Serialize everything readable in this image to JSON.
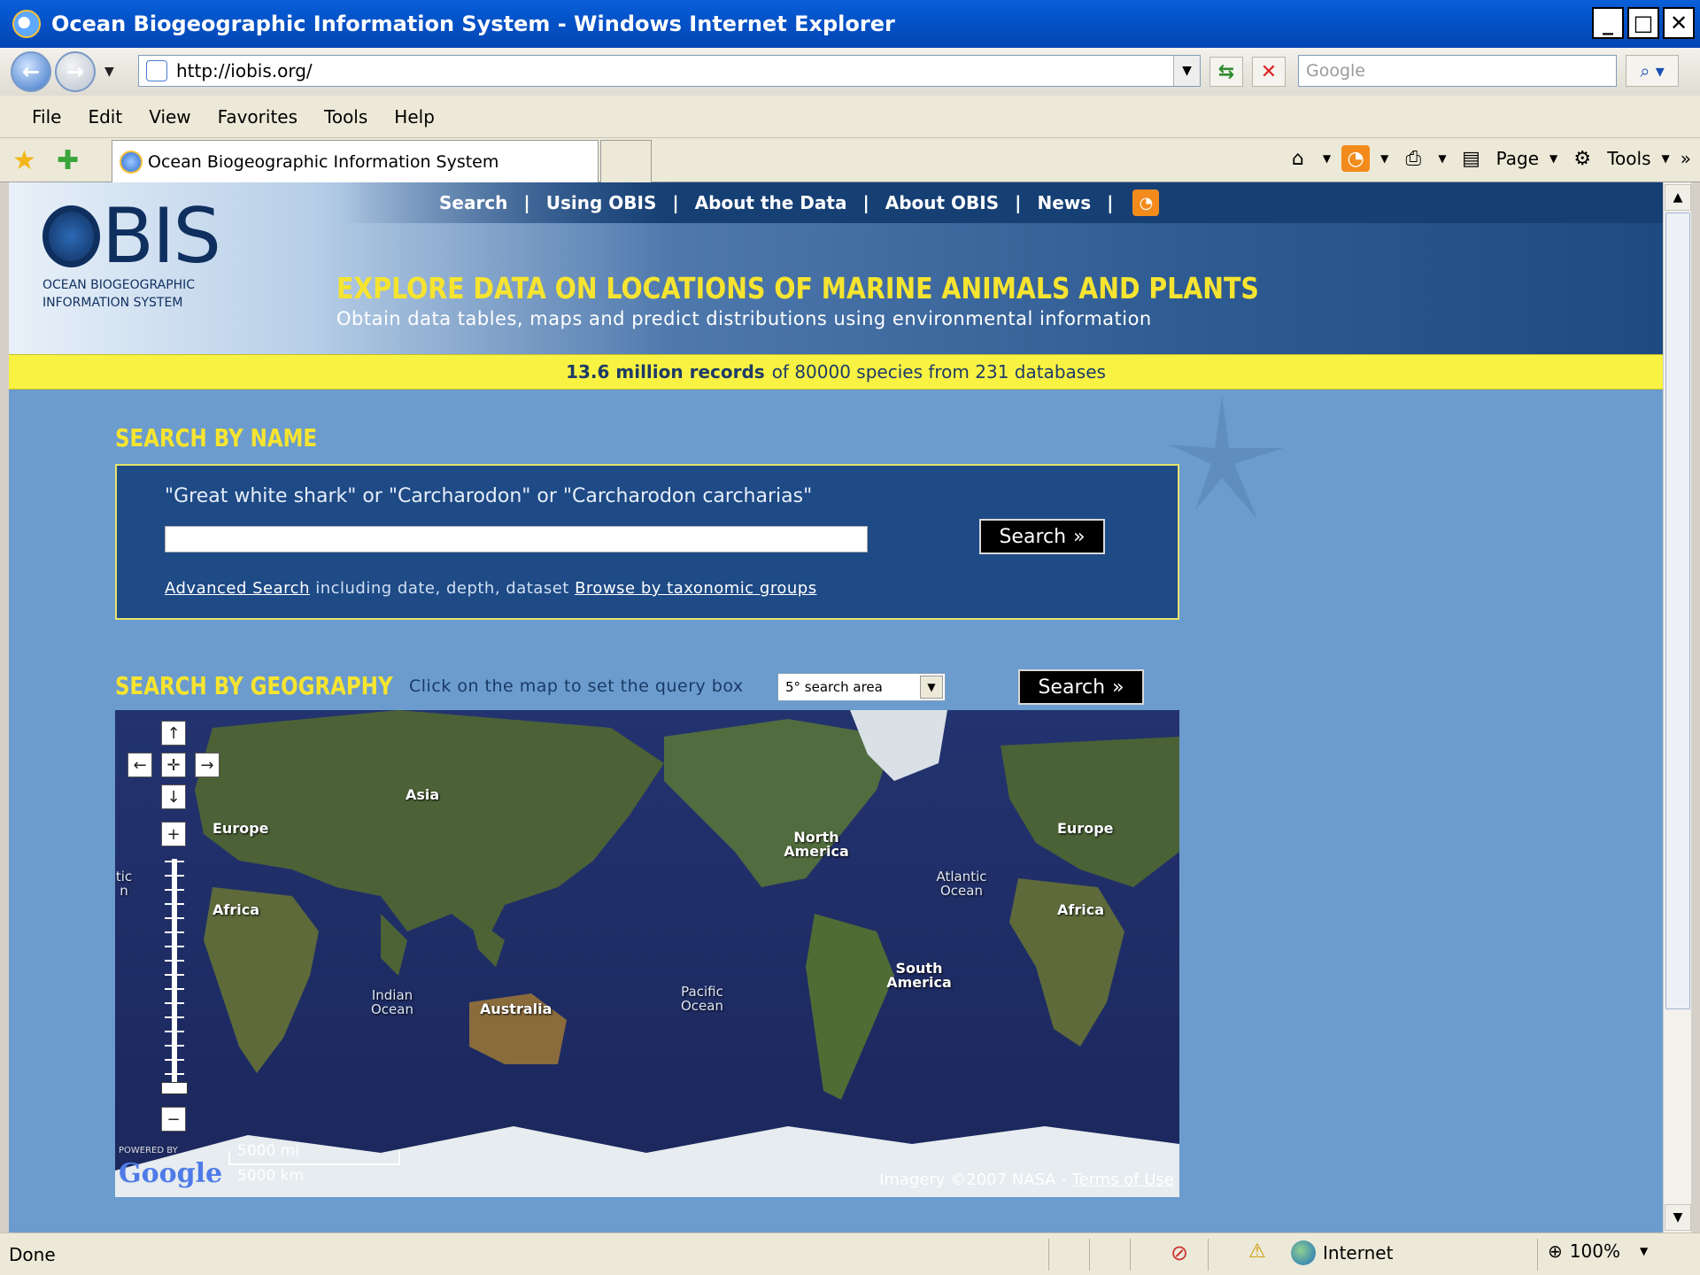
{
  "window": {
    "title": "Ocean Biogeographic Information System - Windows Internet Explorer",
    "controls": [
      "_",
      "□",
      "✕"
    ]
  },
  "navbar": {
    "address": "http://iobis.org/",
    "search_placeholder": "Google"
  },
  "menubar": {
    "items": [
      "File",
      "Edit",
      "View",
      "Favorites",
      "Tools",
      "Help"
    ]
  },
  "tabs": {
    "active_tab": "Ocean Biogeographic Information System",
    "command_page": "Page",
    "command_tools": "Tools",
    "chevron": "»"
  },
  "site": {
    "logo_text": "BIS",
    "logo_sub_1": "OCEAN BIOGEOGRAPHIC",
    "logo_sub_2": "INFORMATION SYSTEM",
    "nav": [
      "Search",
      "Using OBIS",
      "About the Data",
      "About OBIS",
      "News"
    ],
    "nav_sep": "|",
    "hero_title": "EXPLORE DATA ON LOCATIONS OF MARINE ANIMALS AND PLANTS",
    "hero_sub": "Obtain data tables, maps and predict distributions using environmental information",
    "stats_bold": "13.6 million records",
    "stats_rest": "of 80000 species from 231 databases"
  },
  "search_name": {
    "title": "SEARCH BY NAME",
    "hint": "\"Great white shark\" or \"Carcharodon\" or \"Carcharodon carcharias\"",
    "input_value": "",
    "button": "Search",
    "button_arrows": "»",
    "advanced_link": "Advanced Search",
    "advanced_desc": "including date, depth, dataset",
    "browse_link": "Browse by taxonomic groups"
  },
  "search_geo": {
    "title": "SEARCH BY GEOGRAPHY",
    "hint": "Click on the map to set the query box",
    "select_value": "5° search area",
    "button": "Search",
    "button_arrows": "»"
  },
  "map": {
    "labels": {
      "asia": "Asia",
      "europe_left": "Europe",
      "africa_left": "Africa",
      "australia": "Australia",
      "north_america": "North America",
      "south_america": "South America",
      "europe_right": "Europe",
      "africa_right": "Africa"
    },
    "oceans": {
      "indian": "Indian Ocean",
      "pacific": "Pacific Ocean",
      "atlantic": "Atlantic Ocean",
      "atlantic_edge": "tic n"
    },
    "scale_mi": "5000 mi",
    "scale_km": "5000 km",
    "powered_by": "POWERED BY",
    "google": "Google",
    "copyright": "Imagery ©2007 NASA - ",
    "terms": "Terms of Use"
  },
  "statusbar": {
    "status": "Done",
    "zone": "Internet",
    "zoom": "100%"
  }
}
